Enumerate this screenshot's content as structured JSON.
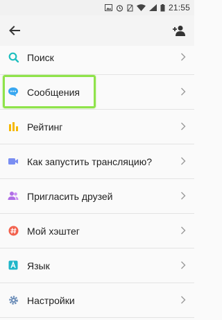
{
  "status_bar": {
    "time": "21:55",
    "icons": [
      "image-icon",
      "alarm-icon",
      "no-sim-icon",
      "wifi-icon",
      "signal-icon",
      "battery-icon"
    ]
  },
  "top_bar": {
    "back_icon": "arrow-left-icon",
    "add_user_icon": "person-add-icon"
  },
  "menu": {
    "items": [
      {
        "label": "Поиск",
        "icon": "search-icon",
        "color": "#1fbfbf"
      },
      {
        "label": "Сообщения",
        "icon": "chat-bubble-icon",
        "color": "#39a7f0",
        "highlighted": true
      },
      {
        "label": "Рейтинг",
        "icon": "bar-chart-icon",
        "color": "#f5b800"
      },
      {
        "label": "Как запустить трансляцию?",
        "icon": "video-camera-icon",
        "color": "#7a8ef2"
      },
      {
        "label": "Пригласить друзей",
        "icon": "people-icon",
        "color": "#b06ee6"
      },
      {
        "label": "Мой хэштег",
        "icon": "hashtag-icon",
        "color": "#f2604c"
      },
      {
        "label": "Язык",
        "icon": "language-icon",
        "color": "#1fb6c9"
      },
      {
        "label": "Настройки",
        "icon": "settings-icon",
        "color": "#6b8db8"
      }
    ]
  },
  "colors": {
    "highlight": "#8fe34a",
    "text": "#1f1f1f",
    "chevron": "#9a9a9a"
  }
}
